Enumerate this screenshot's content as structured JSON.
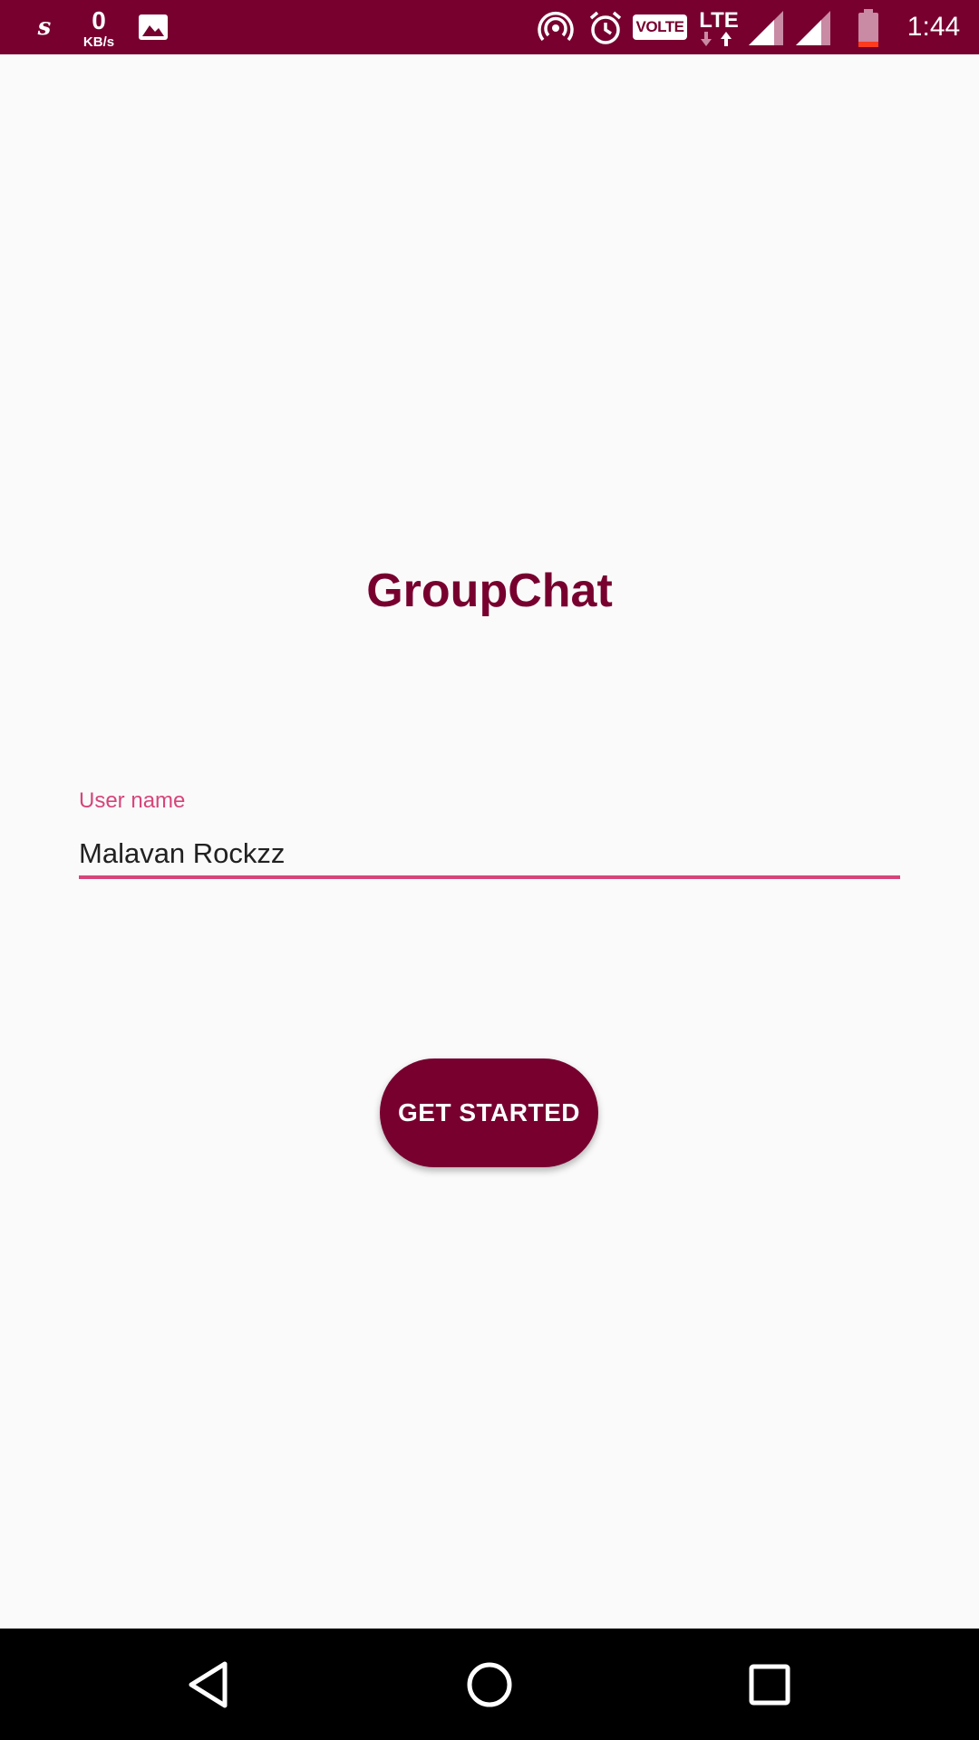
{
  "status_bar": {
    "app_icon": "s",
    "net_speed_value": "0",
    "net_speed_unit": "KB/s",
    "volte_label": "VOLTE",
    "network_type": "LTE",
    "time": "1:44",
    "icons": [
      "gallery-icon",
      "hotspot-icon",
      "alarm-icon",
      "signal-icon",
      "battery-icon"
    ]
  },
  "app": {
    "title": "GroupChat"
  },
  "username_field": {
    "label": "User name",
    "value": "Malavan Rockzz"
  },
  "get_started_button": {
    "label": "GET STARTED"
  },
  "nav_bar": {
    "icons": [
      "back-icon",
      "home-icon",
      "recents-icon"
    ]
  },
  "colors": {
    "primary": "#77002f",
    "accent": "#d6457a",
    "background": "#fafafa"
  }
}
